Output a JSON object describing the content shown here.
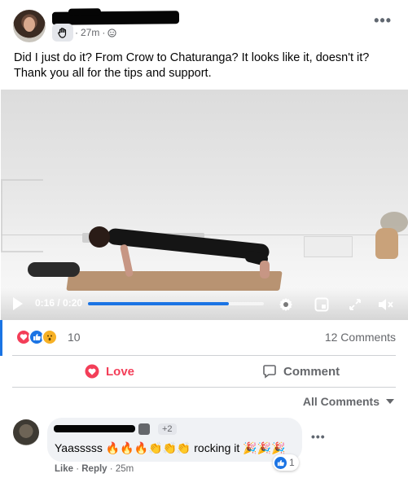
{
  "post": {
    "timestamp": "27m",
    "separator": "·",
    "text": "Did I just do it? From Crow to Chaturanga? It looks like it, doesn't it? Thank you all for the tips and support."
  },
  "video": {
    "current_time": "0:16",
    "duration": "0:20",
    "time_display": "0:16 / 0:20",
    "progress_fraction": 0.8
  },
  "reactions": {
    "count": "10",
    "types": [
      "love",
      "like",
      "wow"
    ],
    "comments_label": "12 Comments"
  },
  "actions": {
    "love_label": "Love",
    "comment_label": "Comment"
  },
  "comments_filter": {
    "label": "All Comments"
  },
  "comment": {
    "badge_extra": "+2",
    "text": "Yaasssss 🔥🔥🔥👏👏👏 rocking it 🎉🎉🎉",
    "reaction_count": "1",
    "like_label": "Like",
    "reply_label": "Reply",
    "time": "25m"
  },
  "colors": {
    "accent_blue": "#1b74e4",
    "love_red": "#f33e58",
    "secondary_text": "#65676b"
  }
}
